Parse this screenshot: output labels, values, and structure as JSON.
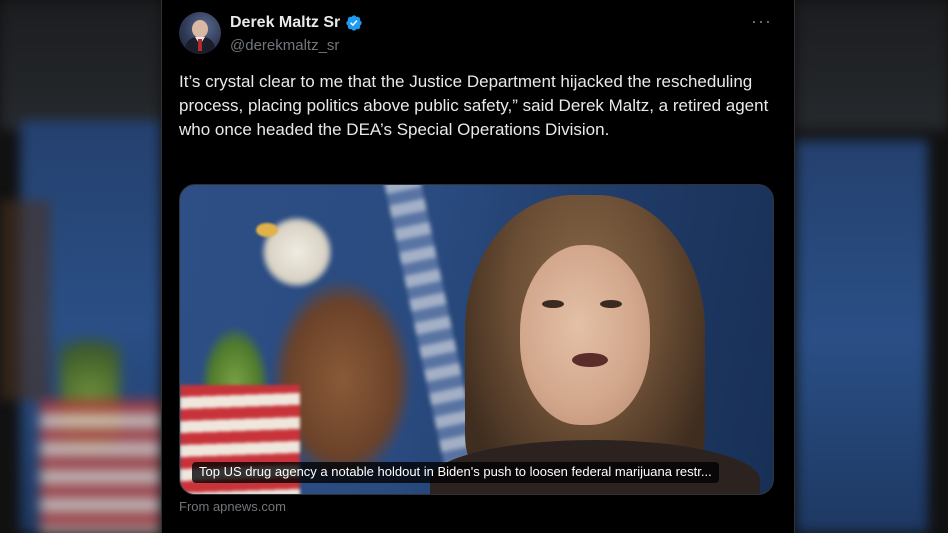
{
  "tweet": {
    "display_name": "Derek Maltz Sr",
    "handle": "@derekmaltz_sr",
    "verified": true,
    "more_label": "···",
    "text": "It’s crystal clear to me that the Justice Department hijacked the rescheduling process, placing politics above public safety,” said Derek Maltz, a retired agent who once headed the DEA’s Special Operations Division.",
    "card": {
      "caption": "Top US drug agency a notable holdout in Biden's push to loosen federal marijuana restr...",
      "source": "From apnews.com"
    }
  },
  "colors": {
    "background": "#000000",
    "text_primary": "#e7e9ea",
    "text_secondary": "#71767b",
    "verified_badge": "#1d9bf0",
    "border": "#2f3336"
  },
  "icons": {
    "verified": "verified-badge-icon",
    "more": "more-options-icon"
  }
}
